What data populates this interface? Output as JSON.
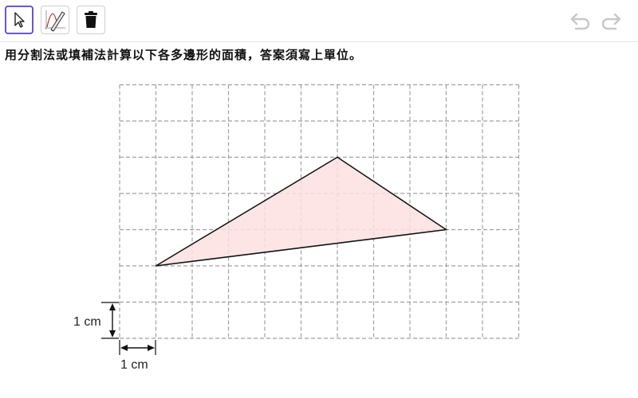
{
  "toolbar": {
    "tools": [
      {
        "name": "move-tool",
        "icon": "cursor-arrow-icon",
        "selected": true
      },
      {
        "name": "freehand-tool",
        "icon": "pen-graph-icon",
        "selected": false
      },
      {
        "name": "delete-tool",
        "icon": "trash-icon",
        "selected": false
      }
    ],
    "undo_icon": "undo-icon",
    "redo_icon": "redo-icon"
  },
  "instruction": "用分割法或填補法計算以下各多邊形的面積，答案須寫上單位。",
  "grid": {
    "columns": 11,
    "rows": 7,
    "line_style": "dashed",
    "line_color": "#a0a0a0"
  },
  "polygon": {
    "vertices_grid_units": [
      [
        1,
        2
      ],
      [
        6,
        5
      ],
      [
        9,
        3
      ]
    ],
    "fill_color": "#fde0e0",
    "stroke_color": "#111111"
  },
  "scale_labels": {
    "vertical": "1 cm",
    "horizontal": "1 cm"
  },
  "colors": {
    "accent": "#6557d2",
    "icon": "#111111",
    "disabled_icon": "#c8c8c8"
  }
}
